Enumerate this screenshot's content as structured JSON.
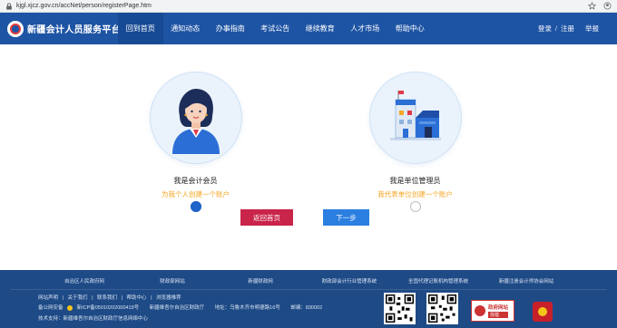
{
  "browser": {
    "url": "kjgl.xjcz.gov.cn/accNet/person/registerPage.htm"
  },
  "header": {
    "site_title": "新疆会计人员服务平台",
    "nav": [
      {
        "label": "回到首页",
        "active": true
      },
      {
        "label": "通知动态",
        "active": false
      },
      {
        "label": "办事指南",
        "active": false
      },
      {
        "label": "考试公告",
        "active": false
      },
      {
        "label": "继续教育",
        "active": false
      },
      {
        "label": "人才市场",
        "active": false
      },
      {
        "label": "帮助中心",
        "active": false
      }
    ],
    "login_label": "登录",
    "separator": "/",
    "register_label": "注册",
    "report_label": "举报"
  },
  "main": {
    "options": [
      {
        "title": "我是会计会员",
        "subtitle": "为我个人创建一个账户",
        "selected": true,
        "icon": "accountant-person-icon"
      },
      {
        "title": "我是单位管理员",
        "subtitle": "我代表单位创建一个账户",
        "selected": false,
        "icon": "building-icon"
      }
    ],
    "back_button": "返回首页",
    "next_button": "下一步"
  },
  "footer": {
    "links": [
      "自治区人民政府网",
      "财政部网站",
      "新疆财政网",
      "财政部会计行业管理系统",
      "全国代理记账机构管理系统",
      "新疆注册会计师协会网站"
    ],
    "info_row1": [
      "网站声明",
      "|",
      "关于我们",
      "|",
      "联系我们",
      "|",
      "帮助中心",
      "|",
      "浏览器推荐"
    ],
    "icp": "新ICP备05010202000419号",
    "sponsor": "新疆维吾尔自治区财政厅",
    "address": "地址：乌鲁木齐市明德路16号",
    "postcode": "邮编：830002",
    "tech_support": "技术支持：新疆维吾尔自治区财政厅信息网络中心",
    "security_record": "备公网安备",
    "gov_badge_line1": "政府网站",
    "gov_badge_line2": "找错"
  },
  "colors": {
    "header_bg": "#1e54a4",
    "footer_bg": "#1e4a86",
    "back_button": "#c9244a",
    "next_button": "#2b7fe0",
    "subtitle": "#f5a623"
  }
}
